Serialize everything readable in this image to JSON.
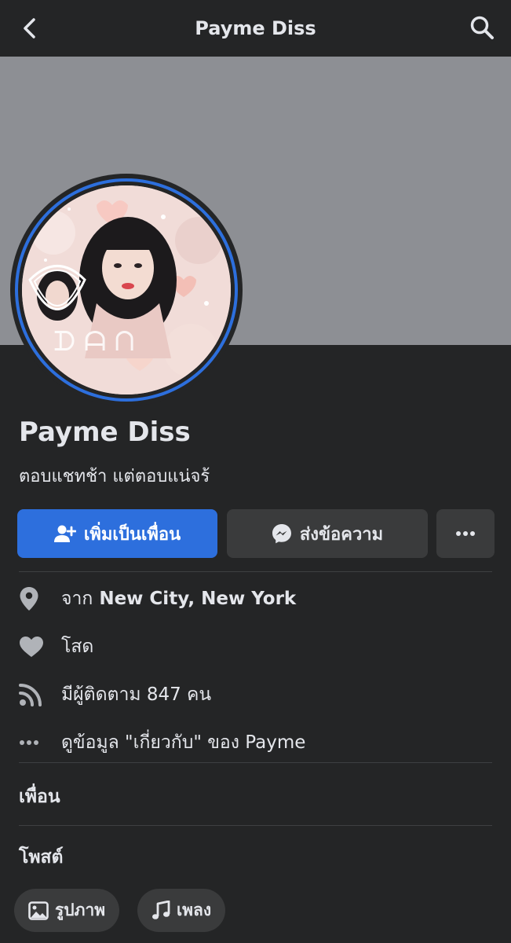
{
  "header": {
    "title": "Payme Diss"
  },
  "profile": {
    "name": "Payme Diss",
    "bio": "ตอบแชทช้า แต่ตอบแน่จร้"
  },
  "actions": {
    "add_friend_label": "เพิ่มเป็นเพื่อน",
    "message_label": "ส่งข้อความ",
    "more_label": "•••"
  },
  "info": {
    "location_prefix": "จาก",
    "location": "New City, New York",
    "relationship": "โสด",
    "followers": "มีผู้ติดตาม 847 คน",
    "about_link": "ดูข้อมูล \"เกี่ยวกับ\" ของ Payme"
  },
  "sections": {
    "friends_title": "เพื่อน",
    "posts_title": "โพสต์"
  },
  "chips": {
    "photos_label": "รูปภาพ",
    "music_label": "เพลง"
  },
  "colors": {
    "background": "#242526",
    "cover": "#8d8f94",
    "accent": "#2d6fdd",
    "button_secondary": "#3a3b3c"
  }
}
